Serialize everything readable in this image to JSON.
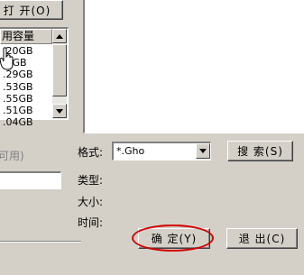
{
  "toolbar": {
    "open_label": "打  开(O)"
  },
  "disk_list": {
    "header": "用容量",
    "rows": [
      ".20GB",
      ".4GB",
      ".29GB",
      ".53GB",
      ".55GB",
      ".51GB",
      ".04GB"
    ]
  },
  "left_panel": {
    "disabled_label": "可用)"
  },
  "file_dialog": {
    "format_label": "格式:",
    "format_value": "*.Gho",
    "search_label": "搜  索(S)",
    "type_label": "类型:",
    "size_label": "大小:",
    "time_label": "时间:"
  },
  "footer": {
    "ok_label": "确  定(Y)",
    "exit_label": "退  出(C)"
  },
  "colors": {
    "highlight": "#d40000",
    "face": "#d4d0c8"
  },
  "icons": {
    "cursor": "hand-pointer-icon",
    "scroll_up": "triangle-up-icon",
    "scroll_down": "triangle-down-icon",
    "combo_arrow": "triangle-down-icon"
  }
}
